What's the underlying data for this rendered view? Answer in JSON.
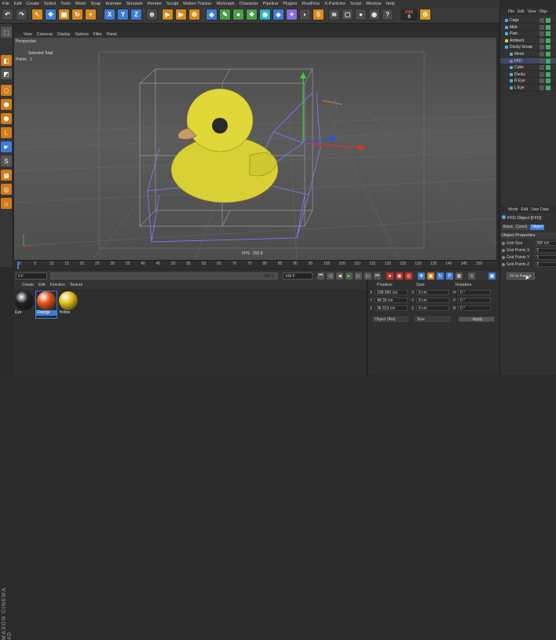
{
  "menubar": [
    "File",
    "Edit",
    "Create",
    "Select",
    "Tools",
    "Mesh",
    "Snap",
    "Animate",
    "Simulate",
    "Render",
    "Sculpt",
    "Motion Tracker",
    "MoGraph",
    "Character",
    "Pipeline",
    "Plugins",
    "RealFlow",
    "X-Particles",
    "Script",
    "Window",
    "Help"
  ],
  "toolbar": {
    "axis_x": "X",
    "axis_y": "Y",
    "axis_z": "Z",
    "fsr_label": "FSR",
    "fsr_value": "0"
  },
  "viewport": {
    "menu": [
      "View",
      "Cameras",
      "Display",
      "Options",
      "Filter",
      "Panel"
    ],
    "camera": "Perspective",
    "selected_total": "Selected Total",
    "points_label": "Points",
    "points_value": "1",
    "fps": "FPS : 250.0"
  },
  "timeline": {
    "ticks": [
      "0",
      "5",
      "10",
      "15",
      "20",
      "25",
      "30",
      "35",
      "40",
      "45",
      "50",
      "55",
      "60",
      "65",
      "70",
      "75",
      "80",
      "85",
      "90",
      "95",
      "100",
      "105",
      "110",
      "115",
      "120",
      "125",
      "130",
      "135",
      "140",
      "145",
      "150"
    ],
    "unit": "0 F"
  },
  "transport": {
    "current_frame": "0 F",
    "start_frame": "0 F",
    "end_frame": "150 F",
    "end_frame2": "150 F"
  },
  "materials": {
    "menu": [
      "Create",
      "Edit",
      "Function",
      "Texture"
    ],
    "items": [
      {
        "label": "Eye",
        "color": "#222222"
      },
      {
        "label": "Orange",
        "color": "#e8561a"
      },
      {
        "label": "Yellow",
        "color": "#e8c21a"
      }
    ]
  },
  "coordinates": {
    "headers": [
      "Position",
      "Size",
      "Rotation"
    ],
    "rows": [
      {
        "axis": "X",
        "pos": "198.966 cm",
        "size_axis": "X",
        "size": "0 cm",
        "rot_axis": "H",
        "rot": "0 °"
      },
      {
        "axis": "Y",
        "pos": "48.39 cm",
        "size_axis": "Y",
        "size": "0 cm",
        "rot_axis": "P",
        "rot": "0 °"
      },
      {
        "axis": "Z",
        "pos": "36.913 cm",
        "size_axis": "Z",
        "size": "0 cm",
        "rot_axis": "B",
        "rot": "0 °"
      }
    ],
    "mode": "Object (Rel)",
    "size_mode": "Size",
    "apply": "Apply"
  },
  "object_manager": {
    "menu": [
      "File",
      "Edit",
      "View",
      "Obje"
    ],
    "objects": [
      {
        "name": "Cage",
        "icon": "#4ab0e0",
        "indent": 0
      },
      {
        "name": "Metr",
        "icon": "#4ab0e0",
        "indent": 0
      },
      {
        "name": "Plan",
        "icon": "#4ab0e0",
        "indent": 0
      },
      {
        "name": "Ambient",
        "icon": "#d0d050",
        "indent": 0
      },
      {
        "name": "Ducky Group",
        "icon": "#4ab0e0",
        "indent": 0
      },
      {
        "name": "Mesh",
        "icon": "#4ab0e0",
        "indent": 1
      },
      {
        "name": "FFD",
        "icon": "#8a6ae0",
        "indent": 1
      },
      {
        "name": "Cube",
        "icon": "#4ab0e0",
        "indent": 1
      },
      {
        "name": "Ducky",
        "icon": "#4ab0e0",
        "indent": 1
      },
      {
        "name": "R Eye",
        "icon": "#4ab0e0",
        "indent": 1
      },
      {
        "name": "L Eye",
        "icon": "#4ab0e0",
        "indent": 1
      }
    ]
  },
  "attributes": {
    "menu": [
      "Mode",
      "Edit",
      "User Data"
    ],
    "title": "FFD Object [FFD]",
    "tabs": [
      "Basic",
      "Coord.",
      "Object"
    ],
    "active_tab": "Object",
    "section": "Object Properties",
    "props": [
      {
        "label": "Grid Size",
        "value": "300 cm"
      },
      {
        "label": "Grid Points X",
        "value": "3"
      },
      {
        "label": "Grid Points Y",
        "value": "3"
      },
      {
        "label": "Grid Points Z",
        "value": "3"
      }
    ],
    "button": "Fit to Parent"
  },
  "brand": "MAXON CINEMA 4D"
}
